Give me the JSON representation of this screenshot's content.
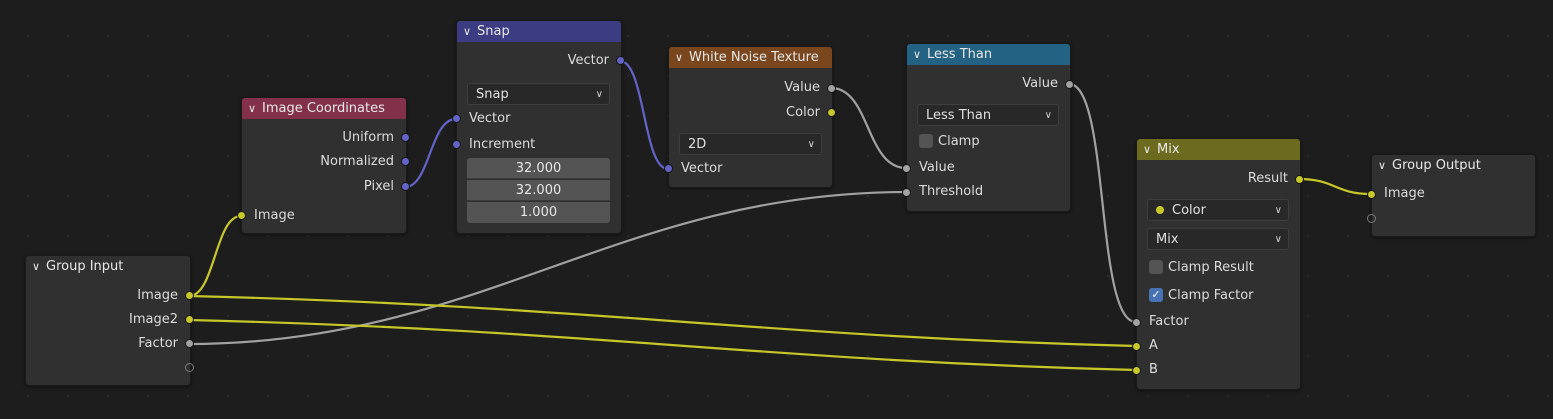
{
  "colors": {
    "background": "#1d1d1d",
    "node_body": "#303030",
    "wire_float": "#a1a1a1",
    "wire_color": "#c7c729",
    "wire_vector": "#6363c7",
    "socket_float": "#a1a1a1",
    "socket_color": "#c7c729",
    "socket_vector": "#6363c7"
  },
  "icons": {
    "collapse": "chevron-down-icon",
    "dropdown": "chevron-down-icon",
    "checked": "checkmark-icon"
  },
  "nodes": {
    "group_input": {
      "title": "Group Input",
      "header_color": "#303030",
      "outputs": [
        "Image",
        "Image2",
        "Factor"
      ]
    },
    "image_coordinates": {
      "title": "Image Coordinates",
      "header_color": "#83314a",
      "outputs": [
        "Uniform",
        "Normalized",
        "Pixel"
      ],
      "inputs": [
        "Image"
      ]
    },
    "snap": {
      "title": "Snap",
      "header_color": "#3c3c83",
      "output": "Vector",
      "mode": "Snap",
      "inputs": [
        "Vector",
        "Increment"
      ],
      "increment_values": [
        "32.000",
        "32.000",
        "1.000"
      ]
    },
    "white_noise": {
      "title": "White Noise Texture",
      "header_color": "#79461d",
      "outputs": [
        "Value",
        "Color"
      ],
      "dimensions": "2D",
      "input": "Vector"
    },
    "less_than": {
      "title": "Less Than",
      "header_color": "#246283",
      "output": "Value",
      "operation": "Less Than",
      "clamp_label": "Clamp",
      "clamp_checked": false,
      "inputs": [
        "Value",
        "Threshold"
      ]
    },
    "mix": {
      "title": "Mix",
      "header_color": "#6c6a1e",
      "output": "Result",
      "data_type": "Color",
      "blend_mode": "Mix",
      "clamp_result_label": "Clamp Result",
      "clamp_result_checked": false,
      "clamp_factor_label": "Clamp Factor",
      "clamp_factor_checked": true,
      "inputs": [
        "Factor",
        "A",
        "B"
      ]
    },
    "group_output": {
      "title": "Group Output",
      "header_color": "#303030",
      "inputs": [
        "Image"
      ]
    }
  }
}
